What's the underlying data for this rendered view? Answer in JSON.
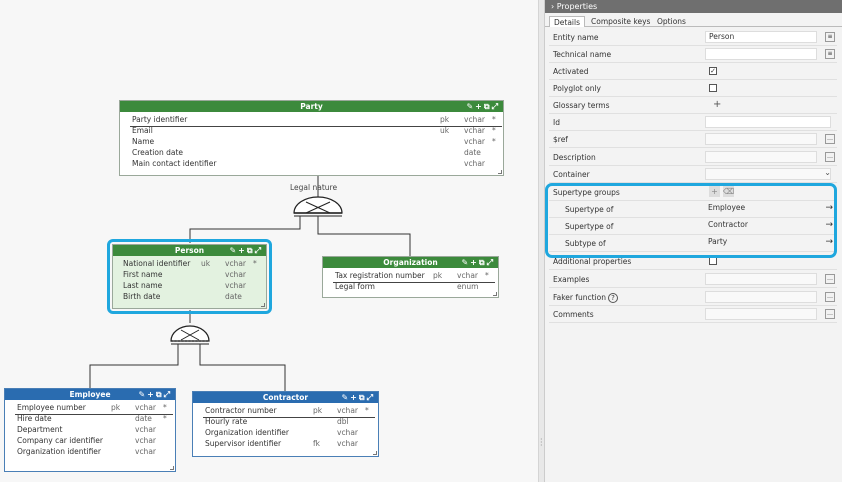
{
  "diagram": {
    "party": {
      "title": "Party",
      "rows": [
        {
          "name": "Party identifier",
          "key": "pk",
          "type": "vchar",
          "req": "*"
        },
        {
          "name": "Email",
          "key": "uk",
          "type": "vchar",
          "req": "*"
        },
        {
          "name": "Name",
          "key": "",
          "type": "vchar",
          "req": "*"
        },
        {
          "name": "Creation date",
          "key": "",
          "type": "date",
          "req": ""
        },
        {
          "name": "Main contact identifier",
          "key": "",
          "type": "vchar",
          "req": ""
        }
      ]
    },
    "legal_nature": "Legal nature",
    "person": {
      "title": "Person",
      "rows": [
        {
          "name": "National identifier",
          "key": "uk",
          "type": "vchar",
          "req": "*"
        },
        {
          "name": "First name",
          "key": "",
          "type": "vchar",
          "req": ""
        },
        {
          "name": "Last name",
          "key": "",
          "type": "vchar",
          "req": ""
        },
        {
          "name": "Birth date",
          "key": "",
          "type": "date",
          "req": ""
        }
      ]
    },
    "organization": {
      "title": "Organization",
      "rows": [
        {
          "name": "Tax registration number",
          "key": "pk",
          "type": "vchar",
          "req": "*"
        },
        {
          "name": "Legal form",
          "key": "",
          "type": "enum",
          "req": ""
        }
      ]
    },
    "employee": {
      "title": "Employee",
      "rows": [
        {
          "name": "Employee number",
          "key": "pk",
          "type": "vchar",
          "req": "*"
        },
        {
          "name": "Hire date",
          "key": "",
          "type": "date",
          "req": "*"
        },
        {
          "name": "Department",
          "key": "",
          "type": "vchar",
          "req": ""
        },
        {
          "name": "Company car identifier",
          "key": "",
          "type": "vchar",
          "req": ""
        },
        {
          "name": "Organization identifier",
          "key": "",
          "type": "vchar",
          "req": ""
        }
      ]
    },
    "contractor": {
      "title": "Contractor",
      "rows": [
        {
          "name": "Contractor number",
          "key": "pk",
          "type": "vchar",
          "req": "*"
        },
        {
          "name": "Hourly rate",
          "key": "",
          "type": "dbl",
          "req": ""
        },
        {
          "name": "Organization identifier",
          "key": "",
          "type": "vchar",
          "req": ""
        },
        {
          "name": "Supervisor identifier",
          "key": "fk",
          "type": "vchar",
          "req": ""
        }
      ]
    },
    "toolbar_icons": "✎+⧉⤢",
    "colors": {
      "green_header": "#3c8a3c",
      "blue_header": "#2a6cb0",
      "selection": "#1fa7de"
    }
  },
  "properties": {
    "title": "Properties",
    "tabs": [
      "Details",
      "Composite keys",
      "Options"
    ],
    "entity_name_label": "Entity name",
    "entity_name_value": "Person",
    "technical_name_label": "Technical name",
    "activated_label": "Activated",
    "polyglot_label": "Polyglot only",
    "glossary_label": "Glossary terms",
    "id_label": "Id",
    "ref_label": "$ref",
    "description_label": "Description",
    "container_label": "Container",
    "supertype_groups_label": "Supertype groups",
    "supertype_of_label": "Supertype of",
    "supertype_of_1": "Employee",
    "supertype_of_2": "Contractor",
    "subtype_of_label": "Subtype of",
    "subtype_of_value": "Party",
    "additional_label": "Additional properties",
    "examples_label": "Examples",
    "faker_label": "Faker function",
    "comments_label": "Comments"
  }
}
